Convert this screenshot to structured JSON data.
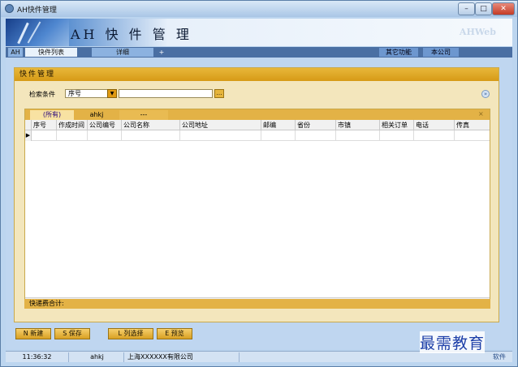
{
  "window": {
    "title": "AH快件管理"
  },
  "header": {
    "title": "AH 快 件 管 理",
    "brand": "AHWeb"
  },
  "tabs": {
    "ah": "AH",
    "list": "快件列表",
    "detail": "详细",
    "plus": "+",
    "other": "其它功能",
    "company": "本公司"
  },
  "panel": {
    "title": "快件管理",
    "search_label": "检索条件",
    "search_field": "序号",
    "search_value": "",
    "grid_tabs": [
      "(所有)",
      "ahkj",
      "---"
    ],
    "columns": [
      "序号",
      "作成时间",
      "公司编号",
      "公司名称",
      "公司地址",
      "邮编",
      "省份",
      "市镇",
      "相关订单",
      "电话",
      "传真"
    ],
    "footer": "快递费合计:"
  },
  "toolbar": {
    "new": "N 新建",
    "save": "S 保存",
    "cols": "L 列选择",
    "preview": "E 预览"
  },
  "status": {
    "time": "11:36:32",
    "user": "ahkj",
    "company": "上海XXXXXX有限公司",
    "soft": "软件"
  },
  "watermark": "最需教育",
  "colors": {
    "accent": "#e3b246",
    "window": "#bcd5ef"
  }
}
